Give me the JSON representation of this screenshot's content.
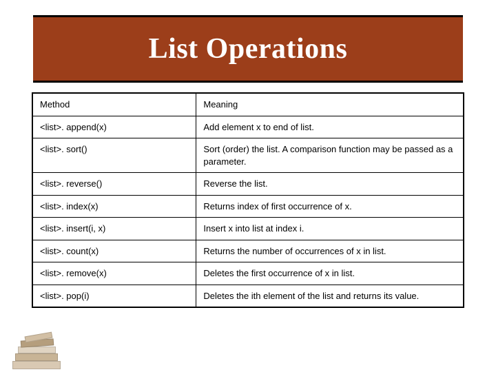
{
  "title": "List Operations",
  "table": {
    "header": {
      "c1": "Method",
      "c2": "Meaning"
    },
    "rows": [
      {
        "method": "<list>. append(x)",
        "meaning": "Add element x to end of list."
      },
      {
        "method": "<list>. sort()",
        "meaning": "Sort (order) the list. A comparison function may be passed as a parameter."
      },
      {
        "method": "<list>. reverse()",
        "meaning": "Reverse the list."
      },
      {
        "method": "<list>. index(x)",
        "meaning": "Returns index of first occurrence of x."
      },
      {
        "method": "<list>. insert(i, x)",
        "meaning": "Insert x into list at index i."
      },
      {
        "method": "<list>. count(x)",
        "meaning": "Returns the number of occurrences of x in list."
      },
      {
        "method": "<list>. remove(x)",
        "meaning": "Deletes the first occurrence of x in list."
      },
      {
        "method": "<list>. pop(i)",
        "meaning": "Deletes the ith element of the list and returns its value."
      }
    ]
  }
}
